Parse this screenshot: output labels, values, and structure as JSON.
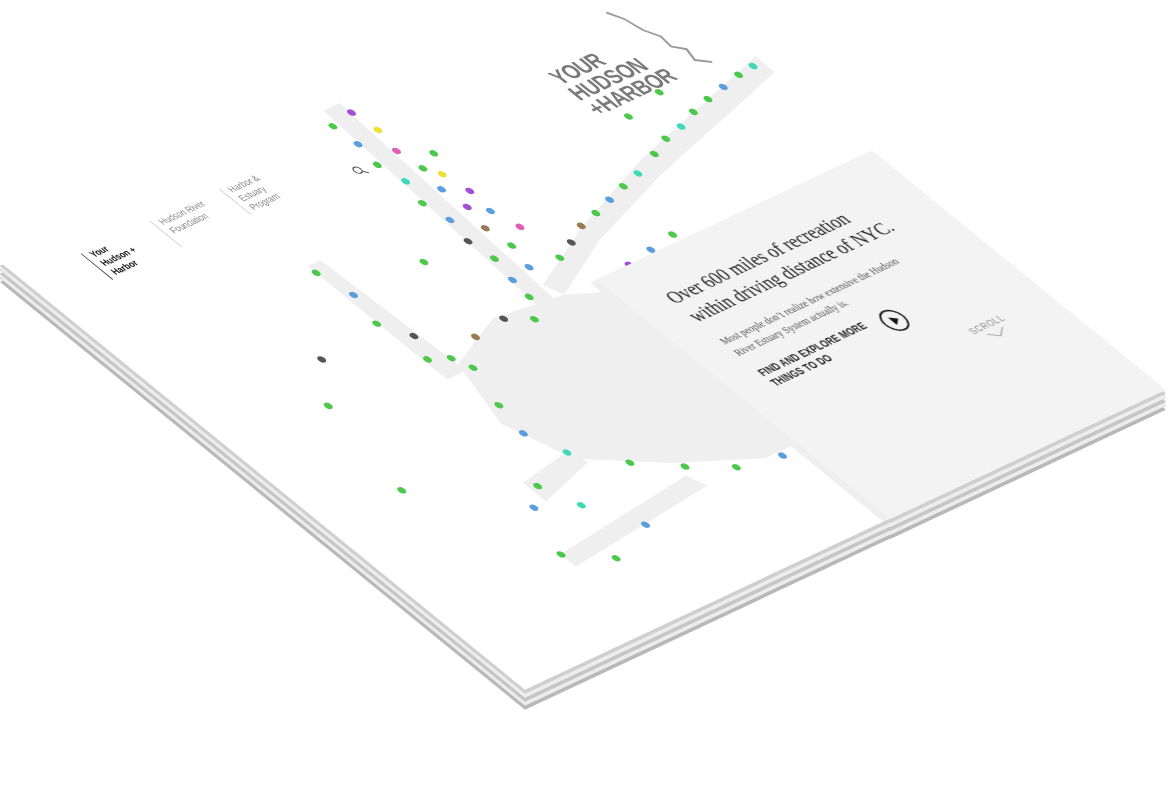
{
  "nav": [
    {
      "label": "Your Hudson + Harbor",
      "selected": true
    },
    {
      "label": "Hudson River Foundation",
      "selected": false
    },
    {
      "label": "Harbor & Estuary Program",
      "selected": false
    }
  ],
  "logo": [
    "YOUR",
    "HUDSON",
    "+HARBOR"
  ],
  "hero": {
    "headline": "Over 600 miles of recreation within driving distance of NYC.",
    "subtext": "Most people don’t realize how extensive the Hudson River Estuary System actually is.",
    "cta": "FIND AND EXPLORE MORE THINGS TO DO",
    "scroll": "SCROLL"
  },
  "map": {
    "pins": [
      {
        "color": "#4cc94a"
      },
      {
        "color": "#5b9ee0"
      },
      {
        "color": "#4cc94a"
      },
      {
        "color": "#3fd9b8"
      },
      {
        "color": "#4cc94a"
      },
      {
        "color": "#5b9ee0"
      },
      {
        "color": "#555555"
      },
      {
        "color": "#4cc94a"
      },
      {
        "color": "#5b9ee0"
      },
      {
        "color": "#4cc94a"
      },
      {
        "color": "#a04fd6"
      },
      {
        "color": "#f0df35"
      },
      {
        "color": "#e05fb5"
      },
      {
        "color": "#4cc94a"
      },
      {
        "color": "#5b9ee0"
      },
      {
        "color": "#a04fd6"
      },
      {
        "color": "#9b7b55"
      },
      {
        "color": "#4cc94a"
      },
      {
        "color": "#5b9ee0"
      },
      {
        "color": "#f0df35"
      },
      {
        "color": "#a04fd6"
      },
      {
        "color": "#5b9ee0"
      },
      {
        "color": "#e05fb5"
      },
      {
        "color": "#4cc94a"
      },
      {
        "color": "#4cc94a"
      },
      {
        "color": "#555555"
      },
      {
        "color": "#9b7b55"
      },
      {
        "color": "#4cc94a"
      },
      {
        "color": "#5b9ee0"
      },
      {
        "color": "#4cc94a"
      },
      {
        "color": "#3fd9b8"
      },
      {
        "color": "#4cc94a"
      },
      {
        "color": "#4cc94a"
      },
      {
        "color": "#3fd9b8"
      },
      {
        "color": "#4cc94a"
      },
      {
        "color": "#4cc94a"
      },
      {
        "color": "#5b9ee0"
      },
      {
        "color": "#4cc94a"
      },
      {
        "color": "#3fd9b8"
      },
      {
        "color": "#4cc94a"
      },
      {
        "color": "#4cc94a"
      },
      {
        "color": "#4cc94a"
      },
      {
        "color": "#5b9ee0"
      },
      {
        "color": "#4cc94a"
      },
      {
        "color": "#555555"
      },
      {
        "color": "#4cc94a"
      },
      {
        "color": "#4cc94a"
      },
      {
        "color": "#4cc94a"
      },
      {
        "color": "#9b7b55"
      },
      {
        "color": "#555555"
      },
      {
        "color": "#4cc94a"
      },
      {
        "color": "#4cc94a"
      },
      {
        "color": "#5b9ee0"
      },
      {
        "color": "#3fd9b8"
      },
      {
        "color": "#4cc94a"
      },
      {
        "color": "#4cc94a"
      },
      {
        "color": "#4cc94a"
      },
      {
        "color": "#5b9ee0"
      },
      {
        "color": "#4cc94a"
      },
      {
        "color": "#4cc94a"
      },
      {
        "color": "#5b9ee0"
      },
      {
        "color": "#3fd9b8"
      },
      {
        "color": "#4cc94a"
      },
      {
        "color": "#4cc94a"
      },
      {
        "color": "#5b9ee0"
      },
      {
        "color": "#a04fd6"
      },
      {
        "color": "#5b9ee0"
      },
      {
        "color": "#4cc94a"
      },
      {
        "color": "#4cc94a"
      },
      {
        "color": "#555555"
      },
      {
        "color": "#4cc94a"
      },
      {
        "color": "#4cc94a"
      }
    ]
  }
}
